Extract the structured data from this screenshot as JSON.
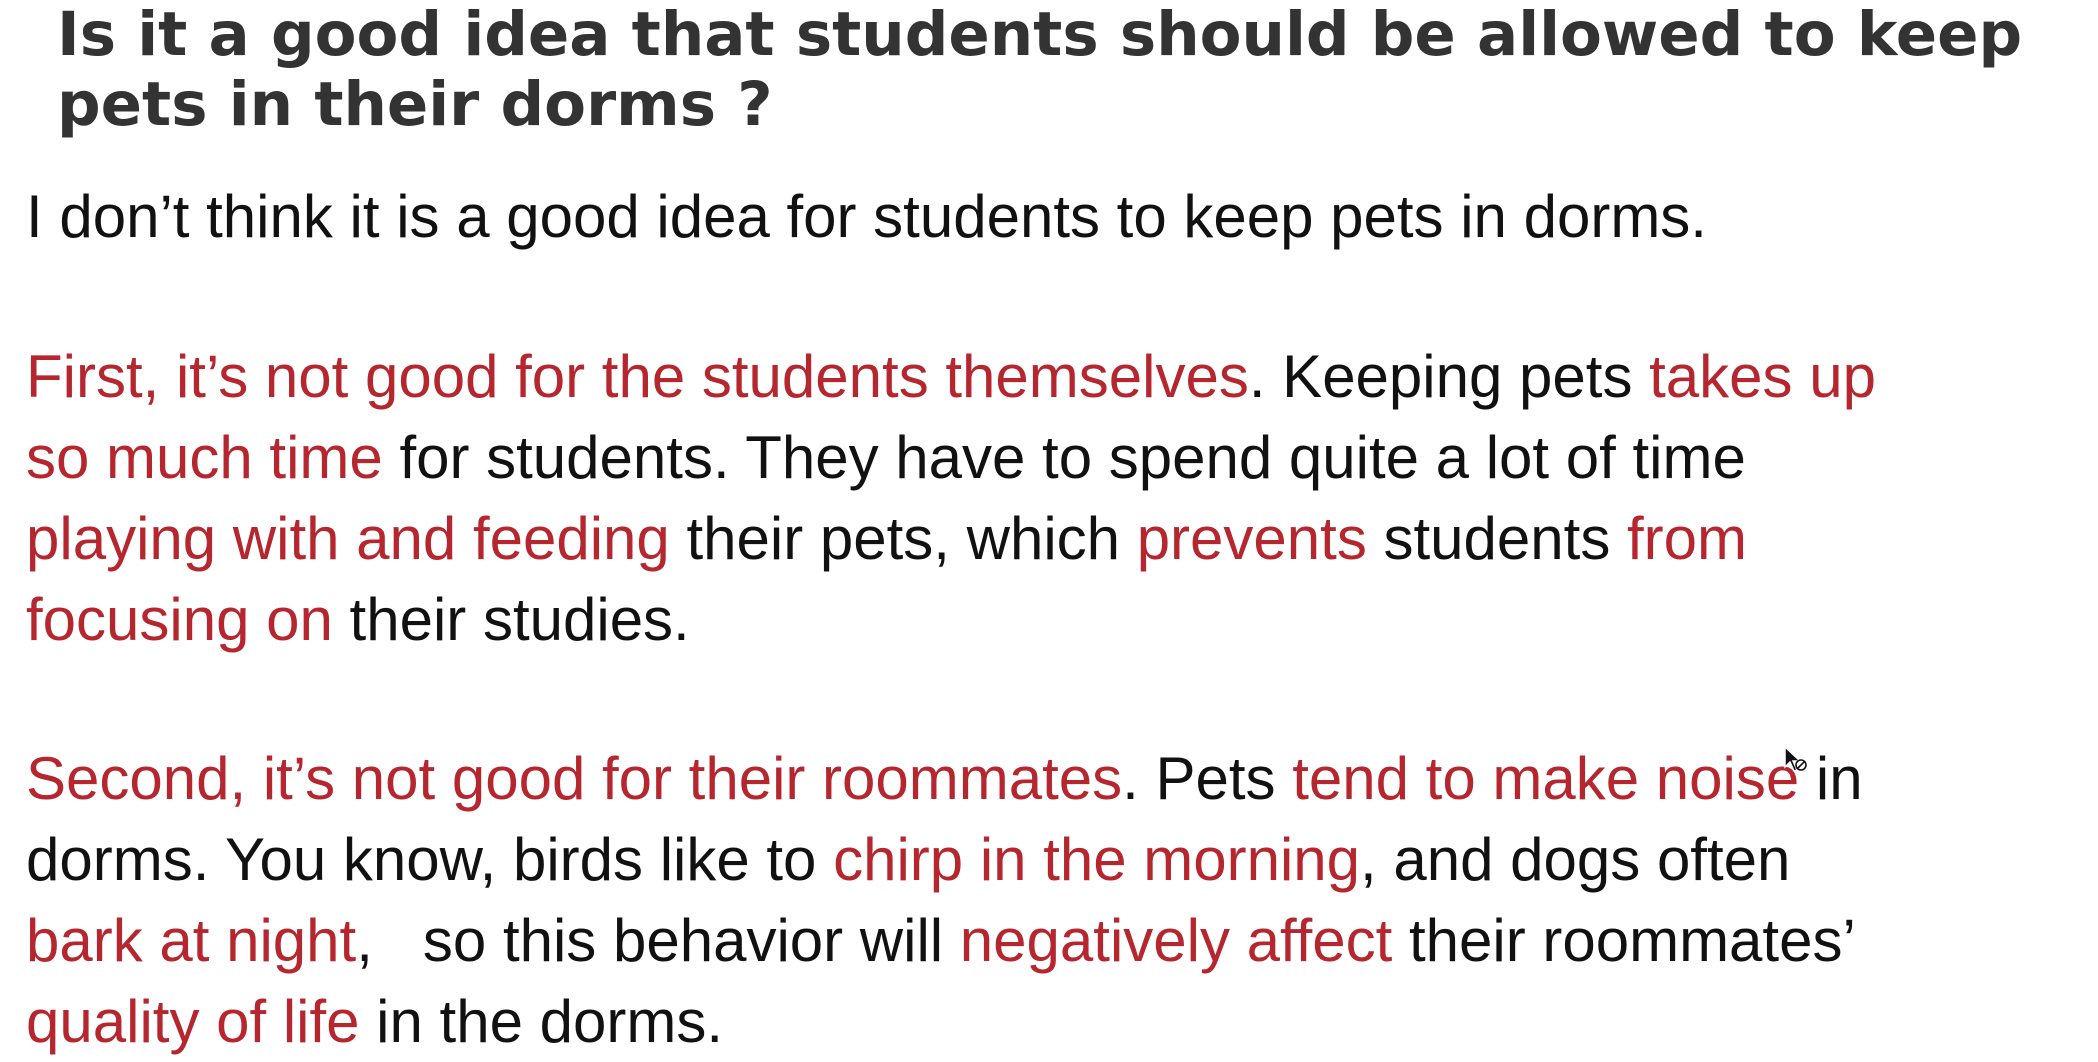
{
  "slide": {
    "title_line1": "Is it a good idea that students should be allowed to keep",
    "title_line2": "pets in their dorms ?",
    "intro": "I don’t think it is a good idea for students to keep pets in dorms.",
    "first": {
      "l1a": "First, it’s not good for the students themselves",
      "l1b": ". Keeping pets ",
      "l1c": "takes up",
      "l2a": "so much time",
      "l2b": " for students. They have to spend quite a lot of time",
      "l3a": "playing with and feeding",
      "l3b": " their pets, which ",
      "l3c": "prevents",
      "l3d": " students ",
      "l3e": "from",
      "l4a": "focusing on",
      "l4b": " their studies."
    },
    "second": {
      "l1a": "Second, it’s not good for their roommates",
      "l1b": ". Pets ",
      "l1c": "tend to make noise",
      "l1d": " in",
      "l2a": "dorms. You know, birds like to ",
      "l2b": "chirp in the morning",
      "l2c": ", and dogs often",
      "l3a": "bark at night",
      "l3b": ",   so this behavior will ",
      "l3c": "negatively affect",
      "l3d": " their roommates’",
      "l4a": "quality of life",
      "l4b": " in the dorms."
    }
  },
  "colors": {
    "title": "#333333",
    "body": "#111111",
    "highlight": "#b5262e"
  },
  "cursor_icon": "mouse-pointer-icon"
}
